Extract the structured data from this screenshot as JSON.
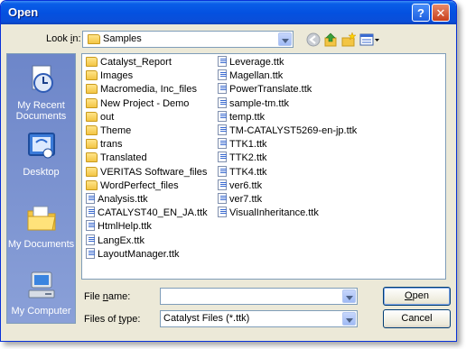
{
  "window": {
    "title": "Open",
    "help_glyph": "?",
    "close_glyph": "✕"
  },
  "look_in": {
    "label_pre": "Look ",
    "label_key": "i",
    "label_post": "n:",
    "value": "Samples",
    "folder_icon": "folder-icon"
  },
  "toolbar": [
    {
      "name": "back-icon"
    },
    {
      "name": "up-one-level-icon"
    },
    {
      "name": "create-new-folder-icon"
    },
    {
      "name": "view-menu-icon"
    }
  ],
  "places": [
    {
      "label": "My Recent Documents",
      "icon": "recent-documents-icon"
    },
    {
      "label": "Desktop",
      "icon": "desktop-icon"
    },
    {
      "label": "My Documents",
      "icon": "my-documents-icon"
    },
    {
      "label": "My Computer",
      "icon": "my-computer-icon"
    }
  ],
  "files_col1": [
    {
      "name": "Catalyst_Report",
      "type": "folder"
    },
    {
      "name": "Images",
      "type": "folder"
    },
    {
      "name": "Macromedia, Inc_files",
      "type": "folder"
    },
    {
      "name": "New Project - Demo",
      "type": "folder"
    },
    {
      "name": "out",
      "type": "folder"
    },
    {
      "name": "Theme",
      "type": "folder"
    },
    {
      "name": "trans",
      "type": "folder"
    },
    {
      "name": "Translated",
      "type": "folder"
    },
    {
      "name": "VERITAS Software_files",
      "type": "folder"
    },
    {
      "name": "WordPerfect_files",
      "type": "folder"
    },
    {
      "name": "Analysis.ttk",
      "type": "file"
    },
    {
      "name": "CATALYST40_EN_JA.ttk",
      "type": "file"
    },
    {
      "name": "HtmlHelp.ttk",
      "type": "file"
    },
    {
      "name": "LangEx.ttk",
      "type": "file"
    },
    {
      "name": "LayoutManager.ttk",
      "type": "file"
    }
  ],
  "files_col2": [
    {
      "name": "Leverage.ttk",
      "type": "file"
    },
    {
      "name": "Magellan.ttk",
      "type": "file"
    },
    {
      "name": "PowerTranslate.ttk",
      "type": "file"
    },
    {
      "name": "sample-tm.ttk",
      "type": "file"
    },
    {
      "name": "temp.ttk",
      "type": "file"
    },
    {
      "name": "TM-CATALYST5269-en-jp.ttk",
      "type": "file"
    },
    {
      "name": "TTK1.ttk",
      "type": "file"
    },
    {
      "name": "TTK2.ttk",
      "type": "file"
    },
    {
      "name": "TTK4.ttk",
      "type": "file"
    },
    {
      "name": "ver6.ttk",
      "type": "file"
    },
    {
      "name": "ver7.ttk",
      "type": "file"
    },
    {
      "name": "VisualInheritance.ttk",
      "type": "file"
    }
  ],
  "file_name": {
    "label_pre": "File ",
    "label_key": "n",
    "label_post": "ame:",
    "value": ""
  },
  "file_type": {
    "label_pre": "Files of ",
    "label_key": "t",
    "label_post": "ype:",
    "value": "Catalyst Files (*.ttk)"
  },
  "buttons": {
    "open_key": "O",
    "open_rest": "pen",
    "cancel": "Cancel"
  },
  "colors": {
    "title_bar": "#0a5ee8",
    "dialog_bg": "#ece9d8",
    "places_bar": "#7a8fc8",
    "border": "#7f9db9"
  }
}
